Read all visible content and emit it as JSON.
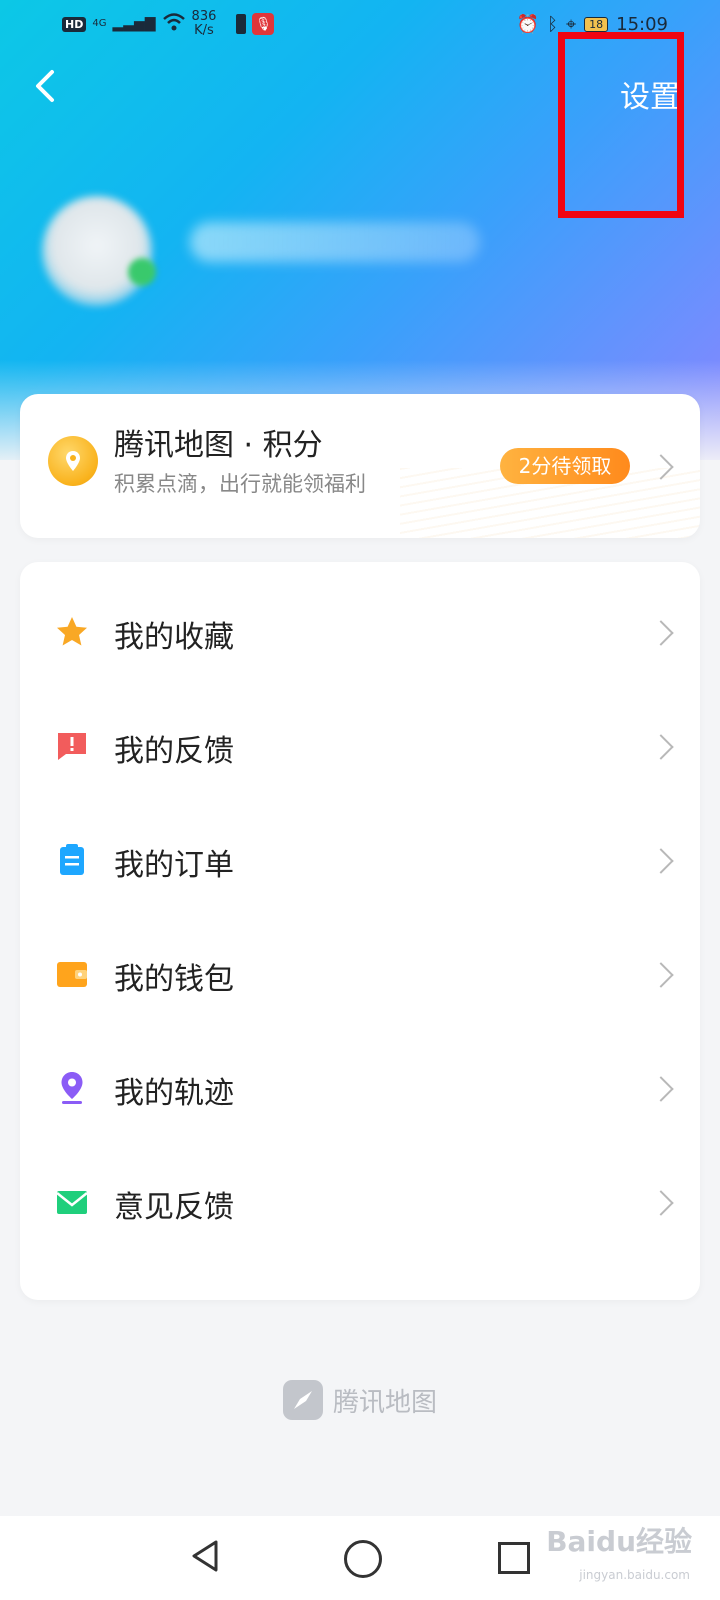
{
  "status_bar": {
    "hd": "HD",
    "network_type": "4G",
    "speed_value": "836",
    "speed_unit": "K/s",
    "battery": "18",
    "time": "15:09"
  },
  "header": {
    "back_icon": "chevron-left-icon",
    "settings_label": "设置"
  },
  "points_card": {
    "title": "腾讯地图 · 积分",
    "subtitle": "积累点滴，出行就能领福利",
    "badge": "2分待领取",
    "icon": "location-coin-icon"
  },
  "menu": {
    "items": [
      {
        "label": "我的收藏",
        "icon": "star-icon",
        "color": "#f9a825"
      },
      {
        "label": "我的反馈",
        "icon": "feedback-icon",
        "color": "#f25c5c"
      },
      {
        "label": "我的订单",
        "icon": "clipboard-icon",
        "color": "#1ea7ff"
      },
      {
        "label": "我的钱包",
        "icon": "wallet-icon",
        "color": "#ffa41c"
      },
      {
        "label": "我的轨迹",
        "icon": "location-pin-icon",
        "color": "#8b5cf6"
      },
      {
        "label": "意见反馈",
        "icon": "mail-icon",
        "color": "#1fcf7c"
      }
    ]
  },
  "footer": {
    "brand": "腾讯地图"
  },
  "watermark": {
    "main": "Baidu经验",
    "sub": "jingyan.baidu.com"
  }
}
